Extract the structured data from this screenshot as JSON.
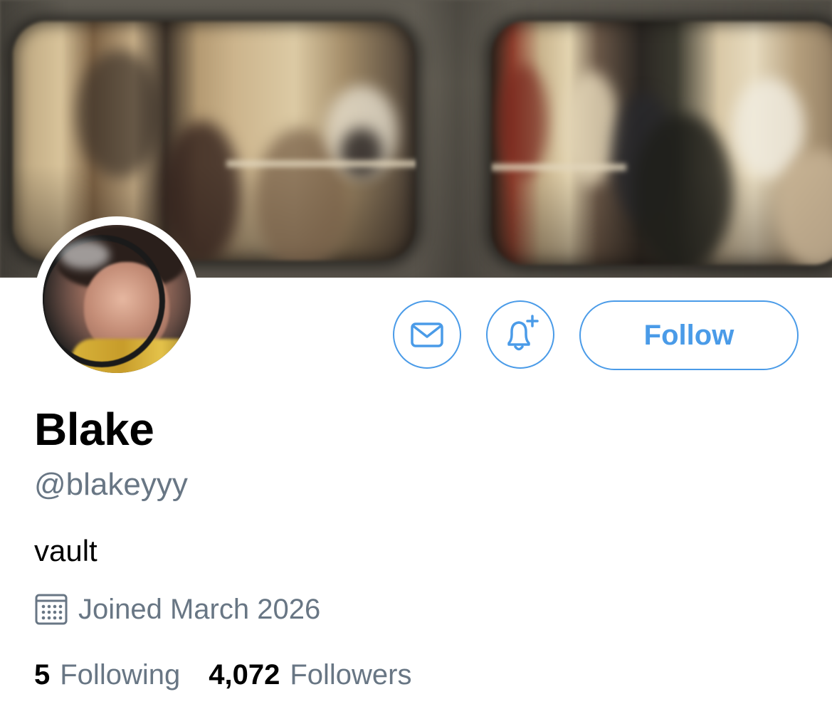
{
  "profile": {
    "display_name": "Blake",
    "handle": "@blakeyyy",
    "bio": "vault",
    "joined": "Joined March 2026"
  },
  "actions": {
    "message_icon": "envelope-icon",
    "notify_icon": "bell-plus-icon",
    "follow_label": "Follow"
  },
  "stats": {
    "following_count": "5",
    "following_label": "Following",
    "followers_count": "4,072",
    "followers_label": "Followers"
  },
  "icons": {
    "joined": "calendar-icon"
  },
  "colors": {
    "accent": "#4a9be8",
    "secondary_text": "#687684",
    "primary_text": "#000000"
  }
}
